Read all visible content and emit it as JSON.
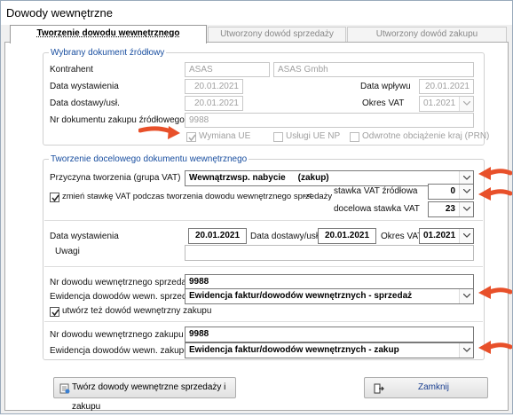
{
  "window": {
    "title": "Dowody wewnętrzne"
  },
  "tabs": [
    {
      "label": "Tworzenie  dowodu wewnętrznego"
    },
    {
      "label": "Utworzony dowód sprzedaży"
    },
    {
      "label": "Utworzony dowód zakupu"
    }
  ],
  "source": {
    "legend": "Wybrany dokument źródłowy",
    "kontrahent_label": "Kontrahent",
    "kontrahent_code": "ASAS",
    "kontrahent_name": "ASAS Gmbh",
    "data_wystawienia_label": "Data wystawienia",
    "data_wystawienia": "20.01.2021",
    "data_wplywu_label": "Data wpływu",
    "data_wplywu": "20.01.2021",
    "data_dostawy_label": "Data dostawy/usł.",
    "data_dostawy": "20.01.2021",
    "okres_vat_label": "Okres VAT",
    "okres_vat": "01.2021",
    "nr_dok_label": "Nr dokumentu  zakupu źródłowego",
    "nr_dok": "9988",
    "wymiana_ue": "Wymiana UE",
    "uslugi_ue_np": "Usługi UE NP",
    "odwrotne": "Odwrotne obciążenie kraj (PRN)"
  },
  "target": {
    "legend": "Tworzenie docelowego dokumentu wewnętrznego",
    "przyczyna_label": "Przyczyna tworzenia (grupa VAT)",
    "przyczyna_value": "Wewnątrzwsp. nabycie     (zakup)",
    "zmien_label": "zmień stawkę VAT podczas tworzenia dowodu wewnętrznego sprzedaży",
    "arrow_glyph": "-<",
    "stawka_zrodlowa_label": "stawka VAT źródłowa",
    "stawka_zrodlowa": "0",
    "docelowa_label": "docelowa stawka VAT",
    "docelowa": "23",
    "data_wystawienia_label": "Data wystawienia",
    "data_wystawienia": "20.01.2021",
    "data_dostawy_label": "Data dostawy/usługi",
    "data_dostawy": "20.01.2021",
    "okres_vat_label": "Okres VAT",
    "okres_vat": "01.2021",
    "uwagi_label": "Uwagi",
    "uwagi_value": "",
    "nr_sprz_label": "Nr dowodu wewnętrznego sprzedaży",
    "nr_sprz": "9988",
    "ewid_sprz_label": "Ewidencja dowodów wewn. sprzedaży",
    "ewid_sprz": "Ewidencja faktur/dowodów wewnętrznych - sprzedaż",
    "utworz_zakup_label": "utwórz też dowód wewnętrzny zakupu",
    "nr_zak_label": "Nr dowodu wewnętrznego zakupu",
    "nr_zak": "9988",
    "ewid_zak_label": "Ewidencja dowodów wewn. zakupu",
    "ewid_zak": "Ewidencja faktur/dowodów wewnętrznych - zakup"
  },
  "buttons": {
    "create": "Twórz dowody wewnętrzne sprzedaży i zakupu",
    "close": "Zamknij"
  },
  "colors": {
    "accent_legend": "#1a4fa0",
    "arrow": "#e8502a"
  }
}
